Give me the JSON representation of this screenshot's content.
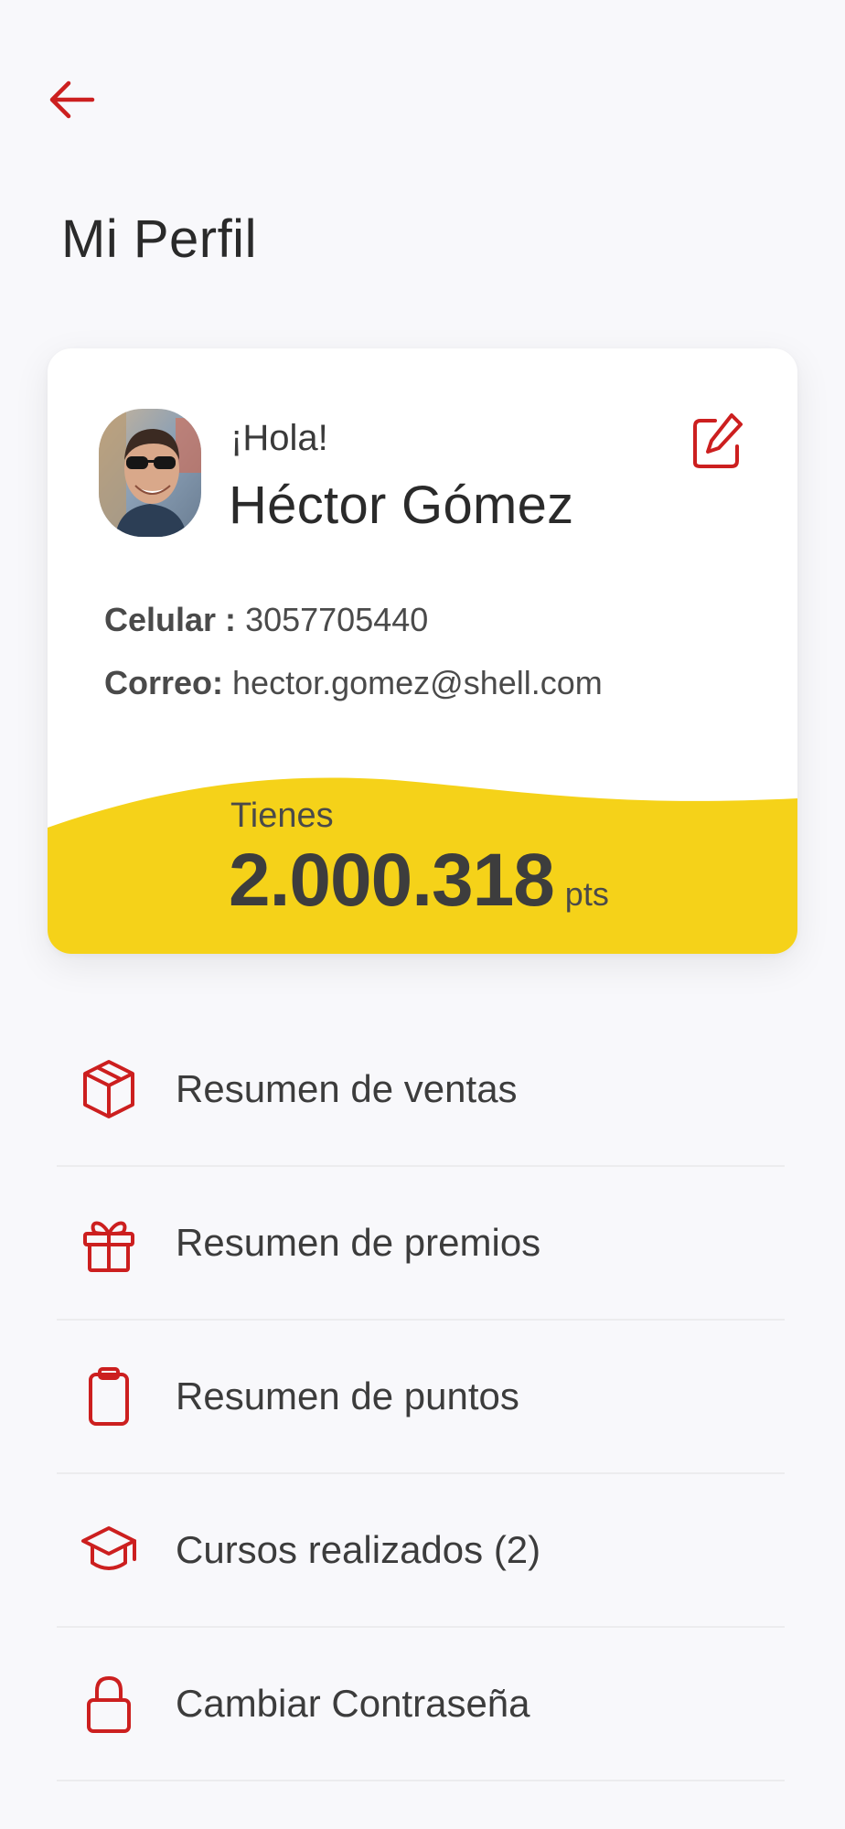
{
  "header": {
    "back_icon": "arrow-left-icon",
    "title": "Mi Perfil"
  },
  "profile": {
    "greeting": "¡Hola!",
    "name": "Héctor Gómez",
    "phone_label": "Celular :",
    "phone": "3057705440",
    "email_label": "Correo:",
    "email": "hector.gomez@shell.com",
    "edit_icon": "edit-icon"
  },
  "points": {
    "label": "Tienes",
    "value": "2.000.318",
    "unit": "pts"
  },
  "menu": [
    {
      "label": "Resumen de ventas",
      "icon": "box-icon"
    },
    {
      "label": "Resumen de premios",
      "icon": "gift-icon"
    },
    {
      "label": "Resumen de puntos",
      "icon": "clipboard-icon"
    },
    {
      "label": "Cursos realizados (2)",
      "icon": "graduation-cap-icon"
    },
    {
      "label": "Cambiar Contraseña",
      "icon": "lock-icon"
    }
  ],
  "colors": {
    "accent": "#cc1f1f",
    "yellow": "#f5d219",
    "background": "#f8f8fb"
  }
}
